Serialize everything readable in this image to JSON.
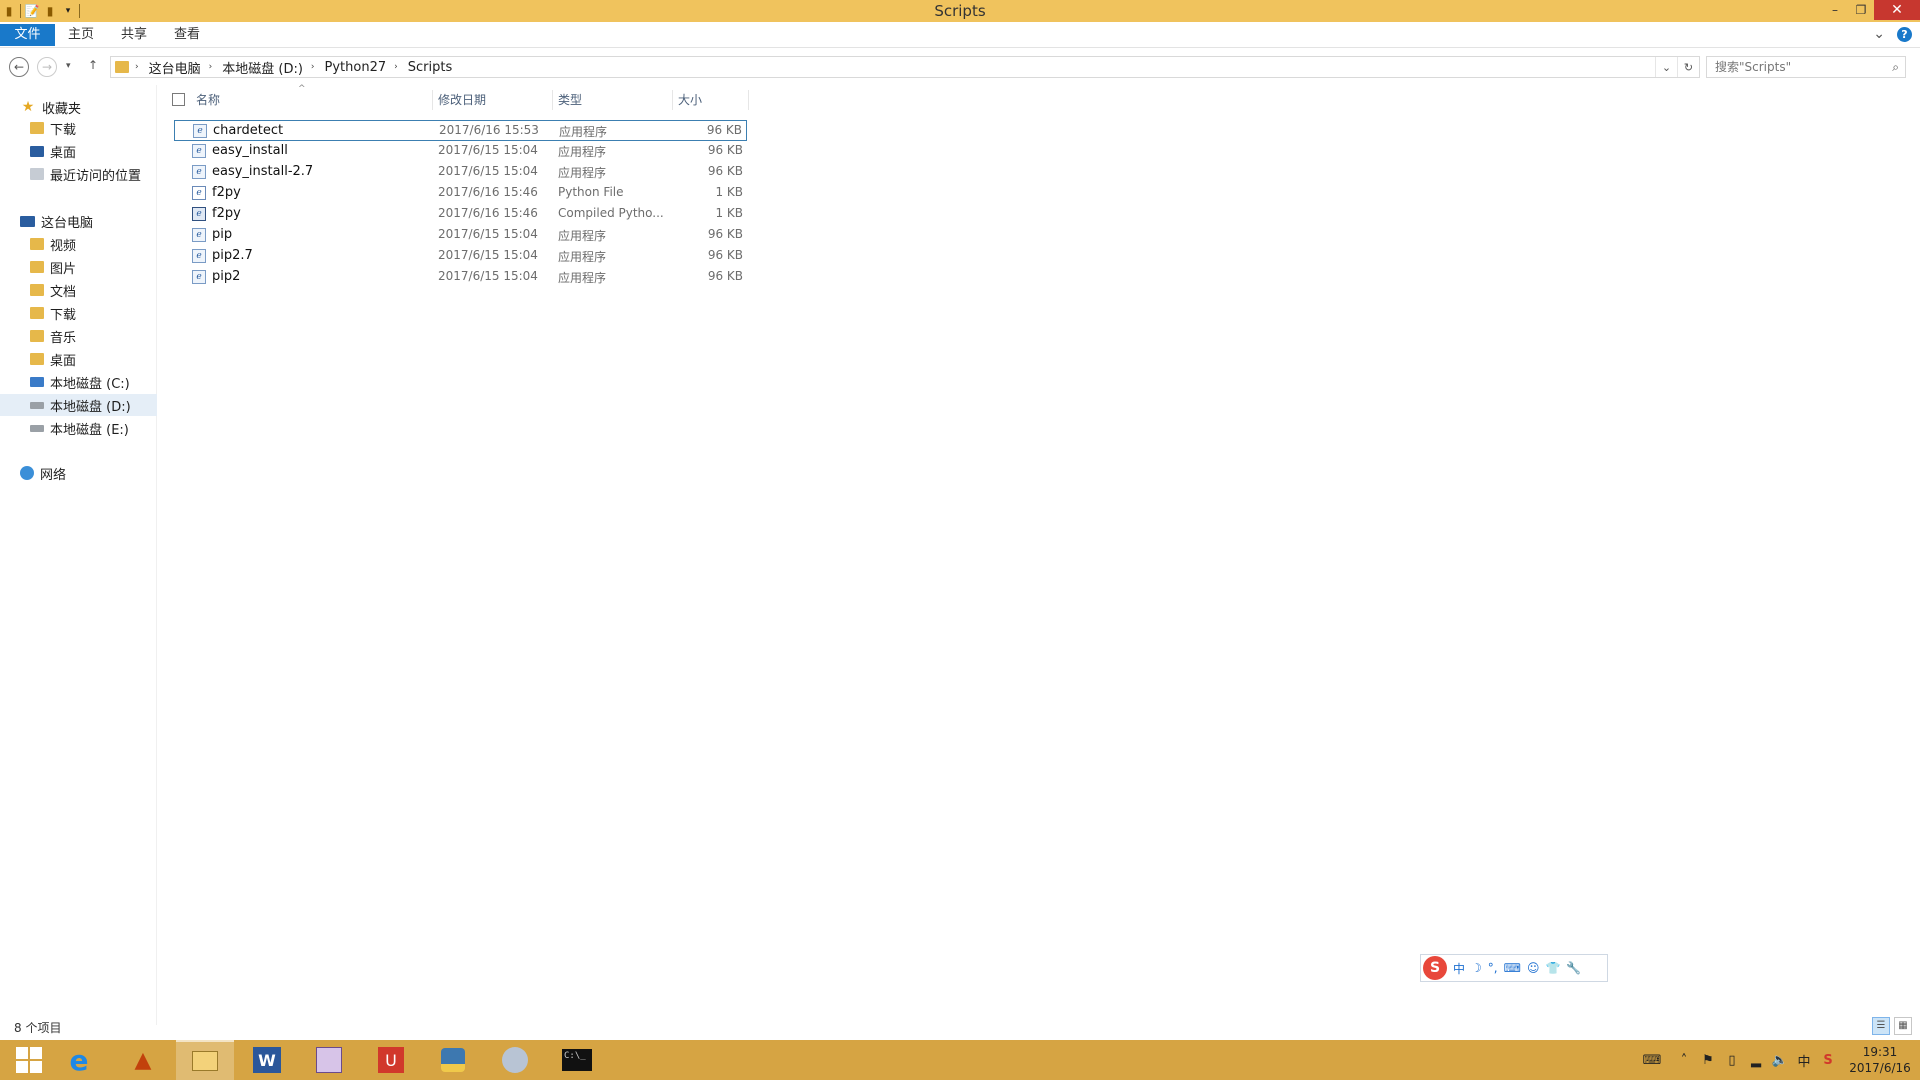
{
  "window": {
    "title": "Scripts",
    "controls": {
      "minimize": "–",
      "restore": "❐",
      "close": "✕"
    }
  },
  "ribbon": {
    "tabs": [
      "文件",
      "主页",
      "共享",
      "查看"
    ],
    "help": "?",
    "expand": "⌄"
  },
  "address": {
    "crumbs": [
      "这台电脑",
      "本地磁盘 (D:)",
      "Python27",
      "Scripts"
    ],
    "search_placeholder": "搜索\"Scripts\""
  },
  "sidebar": {
    "favorites_label": "收藏夹",
    "favorites": [
      "下载",
      "桌面",
      "最近访问的位置"
    ],
    "pc_label": "这台电脑",
    "pc_items": [
      "视频",
      "图片",
      "文档",
      "下载",
      "音乐",
      "桌面",
      "本地磁盘 (C:)",
      "本地磁盘 (D:)",
      "本地磁盘 (E:)"
    ],
    "network_label": "网络",
    "selected": "本地磁盘 (D:)"
  },
  "columns": {
    "name": "名称",
    "modified": "修改日期",
    "type": "类型",
    "size": "大小"
  },
  "files": [
    {
      "name": "chardetect",
      "modified": "2017/6/16 15:53",
      "type": "应用程序",
      "size": "96 KB",
      "icon": "py-exe-icon",
      "selected": true
    },
    {
      "name": "easy_install",
      "modified": "2017/6/15 15:04",
      "type": "应用程序",
      "size": "96 KB",
      "icon": "py-exe-icon"
    },
    {
      "name": "easy_install-2.7",
      "modified": "2017/6/15 15:04",
      "type": "应用程序",
      "size": "96 KB",
      "icon": "py-exe-icon"
    },
    {
      "name": "f2py",
      "modified": "2017/6/16 15:46",
      "type": "Python File",
      "size": "1 KB",
      "icon": "python-file-icon"
    },
    {
      "name": "f2py",
      "modified": "2017/6/16 15:46",
      "type": "Compiled Pytho...",
      "size": "1 KB",
      "icon": "compiled-python-icon"
    },
    {
      "name": "pip",
      "modified": "2017/6/15 15:04",
      "type": "应用程序",
      "size": "96 KB",
      "icon": "py-exe-icon"
    },
    {
      "name": "pip2.7",
      "modified": "2017/6/15 15:04",
      "type": "应用程序",
      "size": "96 KB",
      "icon": "py-exe-icon"
    },
    {
      "name": "pip2",
      "modified": "2017/6/15 15:04",
      "type": "应用程序",
      "size": "96 KB",
      "icon": "py-exe-icon"
    }
  ],
  "status": {
    "item_count": "8 个项目"
  },
  "ime": {
    "logo": "S",
    "mode": "中",
    "items": [
      "☽",
      "°,",
      "⌨",
      "☺",
      "👕",
      "🔧"
    ]
  },
  "taskbar": {
    "time": "19:31",
    "date": "2017/6/16",
    "tray_lang": "中"
  }
}
